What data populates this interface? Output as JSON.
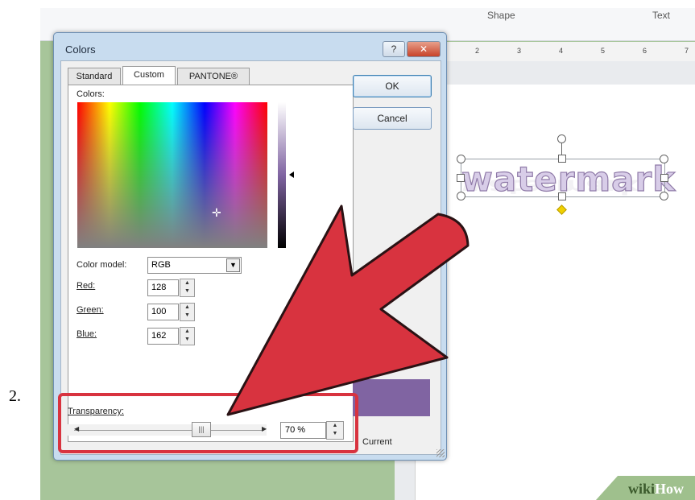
{
  "step_number": "2.",
  "background": {
    "ribbon_labels": [
      "Shape",
      "Text"
    ],
    "ruler_numbers": [
      "2",
      "3",
      "4",
      "5",
      "6",
      "7"
    ],
    "watermark_text": "watermark",
    "wikihow_prefix": "wiki",
    "wikihow_suffix": "How"
  },
  "dialog": {
    "title": "Colors",
    "help_label": "?",
    "close_label": "✕",
    "tabs": [
      {
        "label": "Standard",
        "active": false
      },
      {
        "label": "Custom",
        "active": true
      },
      {
        "label": "PANTONE®",
        "active": false
      }
    ],
    "colors_label": "Colors:",
    "color_model_label": "Color model:",
    "color_model_value": "RGB",
    "red_label": "Red:",
    "red_value": "128",
    "green_label": "Green:",
    "green_value": "100",
    "blue_label": "Blue:",
    "blue_value": "162",
    "transparency_label": "Transparency:",
    "transparency_value": "70 %",
    "transparency_fraction": 0.7,
    "ok_label": "OK",
    "cancel_label": "Cancel",
    "current_label": "Current",
    "selected_color": "#8064a2"
  },
  "colors": {
    "highlight_red": "#d8333f",
    "dialog_frame": "#c8dcef"
  }
}
